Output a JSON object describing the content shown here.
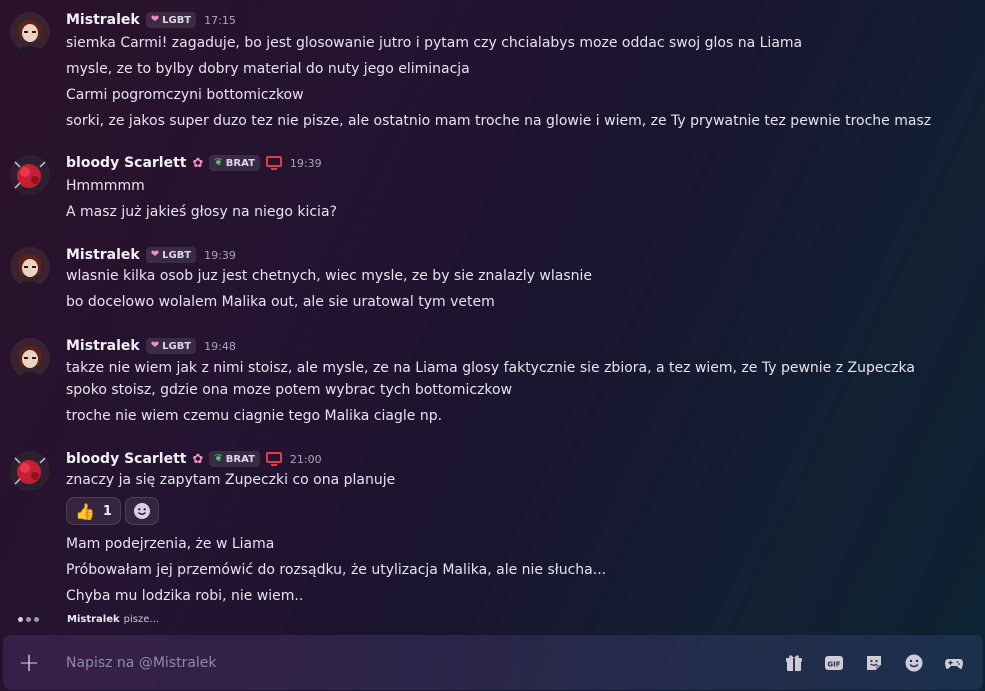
{
  "messages": [
    {
      "user": "Mistralek",
      "avatar": "mistralek",
      "tag": {
        "icon": "heart-icon",
        "label": "LGBT"
      },
      "time": "17:15",
      "lines": [
        "siemka Carmi! zagaduje, bo jest glosowanie jutro i pytam czy chcialabys moze oddac swoj glos na Liama",
        "mysle, ze to bylby dobry material do nuty jego eliminacja",
        "Carmi pogromczyni bottomiczkow",
        "sorki, ze jakos super duzo tez nie pisze, ale ostatnio mam troche na glowie i wiem, ze Ty prywatnie tez pewnie troche masz"
      ]
    },
    {
      "user": "bloody Scarlett",
      "avatar": "scarlett",
      "flower": "✿",
      "tag": {
        "icon": "leaf-icon",
        "label": "BRAT"
      },
      "time": "19:39",
      "lines": [
        "Hmmmmm",
        "A masz już jakieś głosy na niego kicia?"
      ]
    },
    {
      "user": "Mistralek",
      "avatar": "mistralek",
      "tag": {
        "icon": "heart-icon",
        "label": "LGBT"
      },
      "time": "19:39",
      "lines": [
        "wlasnie kilka osob juz jest chetnych, wiec mysle, ze by sie znalazly wlasnie",
        "bo docelowo wolalem Malika out, ale sie uratowal tym vetem"
      ]
    },
    {
      "user": "Mistralek",
      "avatar": "mistralek",
      "tag": {
        "icon": "heart-icon",
        "label": "LGBT"
      },
      "time": "19:48",
      "lines": [
        "takze nie wiem jak z nimi stoisz, ale mysle, ze na Liama glosy faktycznie sie zbiora, a tez wiem, ze Ty pewnie z Zupeczka spoko stoisz, gdzie ona moze potem wybrac tych bottomiczkow",
        "troche nie wiem czemu ciagnie tego Malika ciagle np."
      ]
    },
    {
      "user": "bloody Scarlett",
      "avatar": "scarlett",
      "flower": "✿",
      "tag": {
        "icon": "leaf-icon",
        "label": "BRAT"
      },
      "time": "21:00",
      "lines": [
        "znaczy ja się zapytam Zupeczki co ona planuje",
        "Mam podejrzenia, że w Liama",
        "Próbowałam jej przemówić do rozsądku, że utylizacja Malika, ale nie słucha...",
        "Chyba mu lodzika robi, nie wiem.."
      ],
      "reaction": {
        "emoji": "👍",
        "count": "1"
      }
    }
  ],
  "typing": {
    "name": "Mistralek",
    "suffix": "pisze..."
  },
  "composer": {
    "placeholder": "Napisz na @Mistralek"
  },
  "colors": {
    "heart": "#f28bd8",
    "leaf": "#4fd06a",
    "monitor": "#e23b4a"
  },
  "tools": [
    "gift-icon",
    "gif-icon",
    "sticker-icon",
    "emoji-icon",
    "game-icon"
  ]
}
